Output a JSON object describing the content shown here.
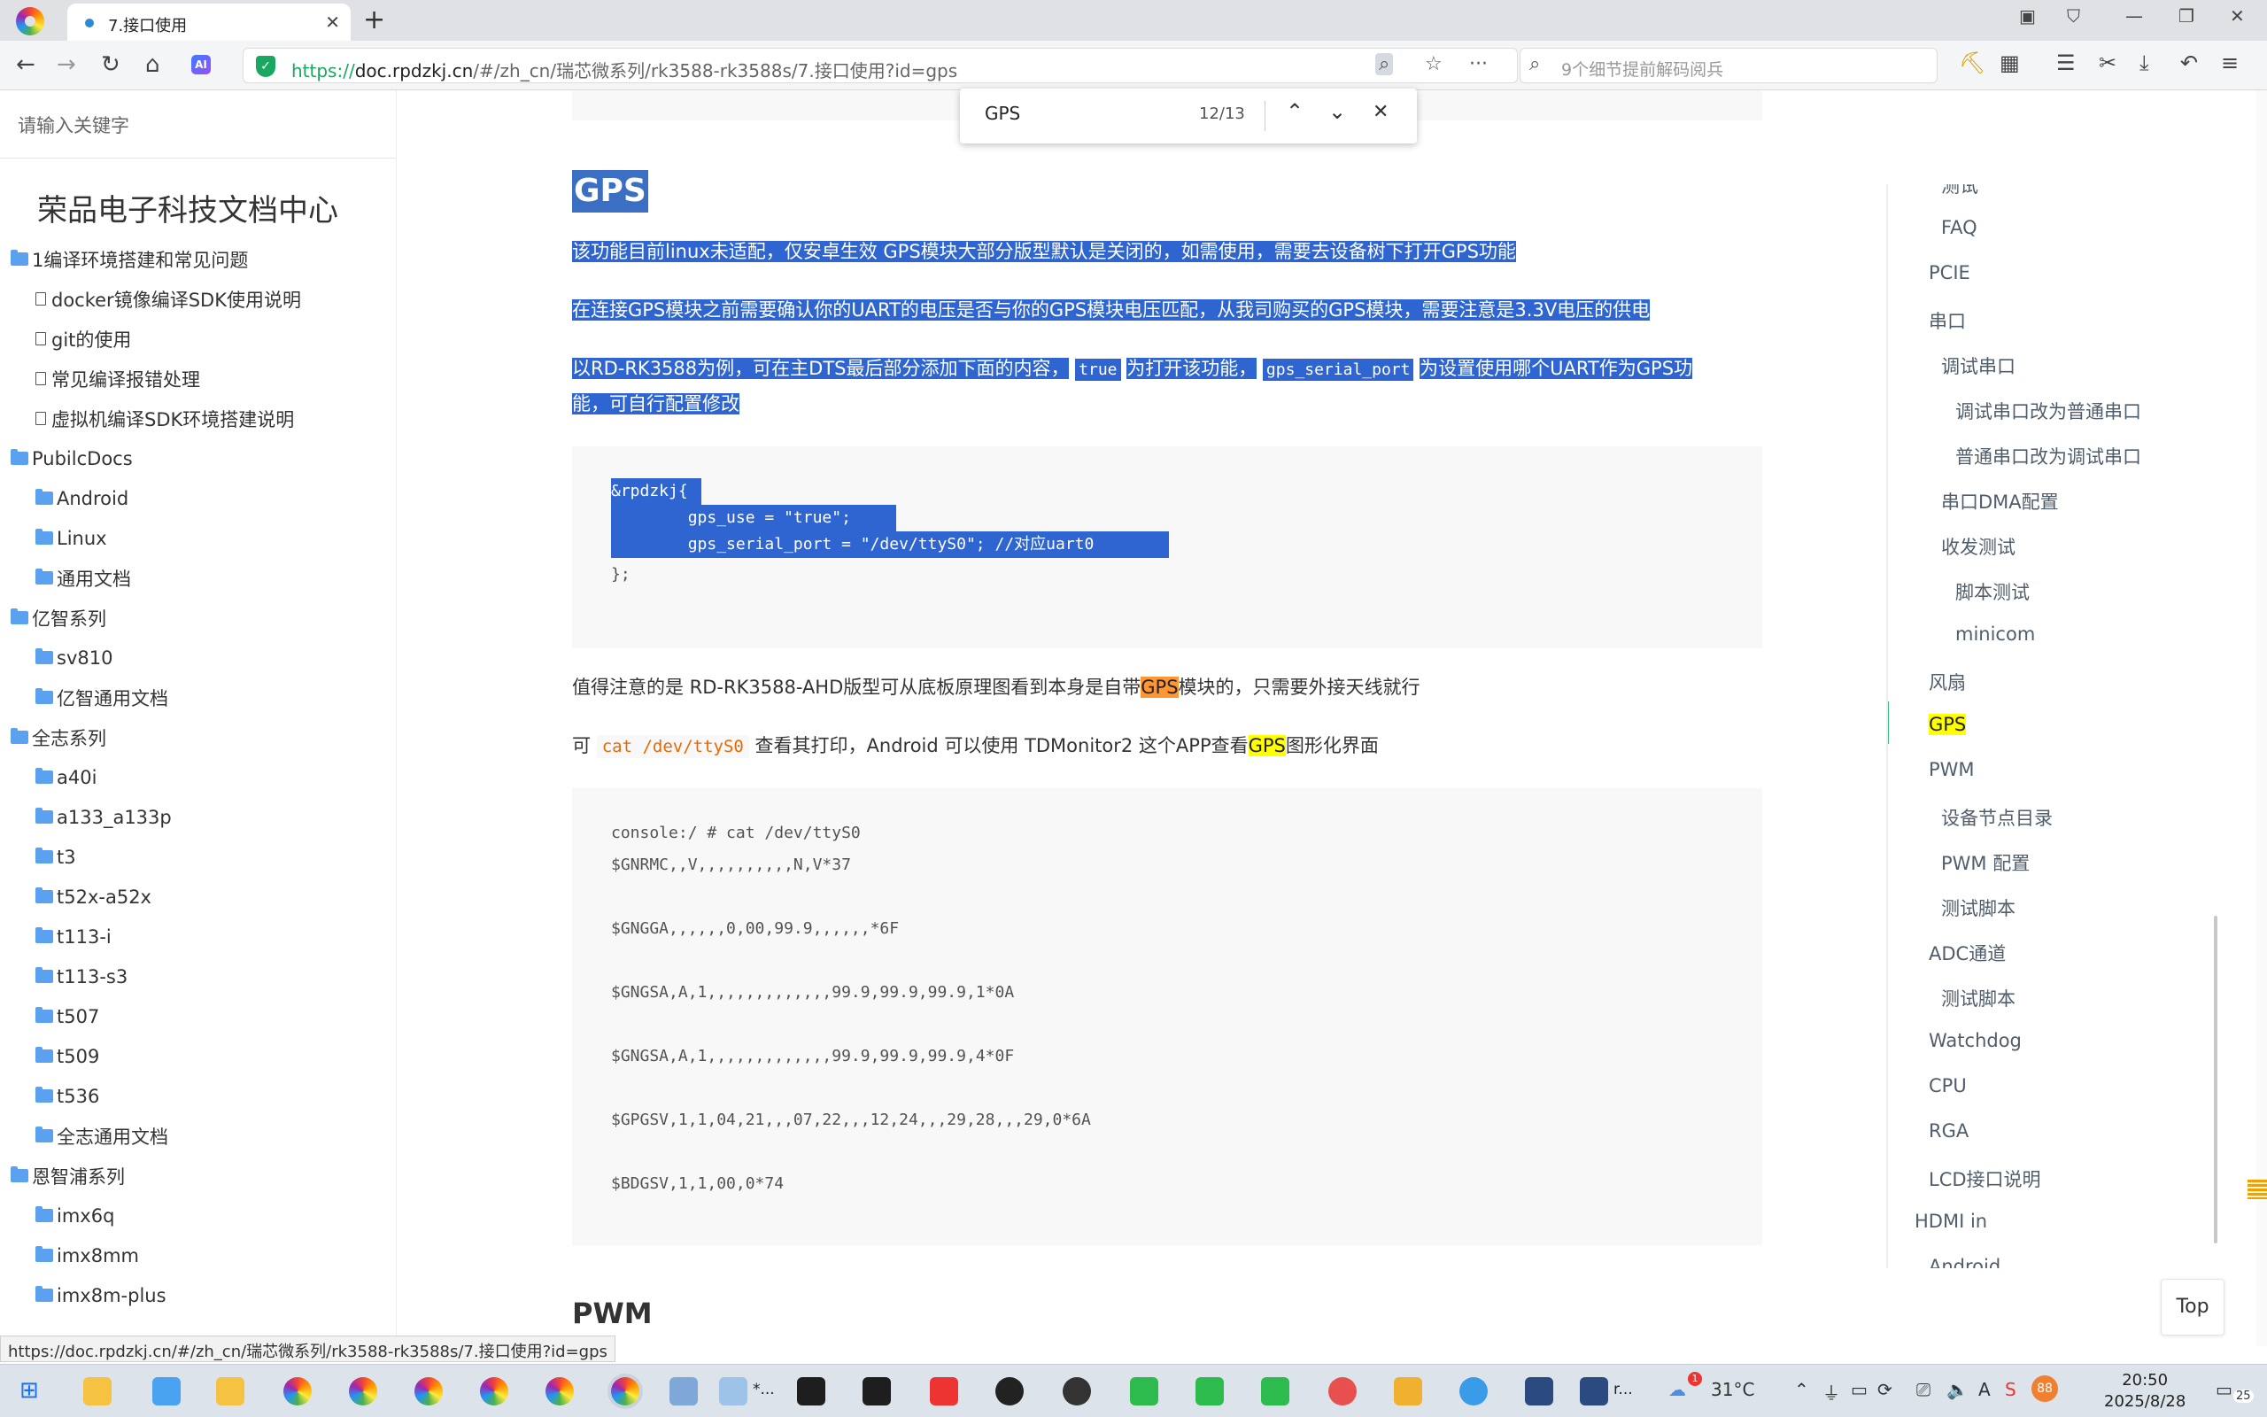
{
  "browser": {
    "tab_title": "7.接口使用",
    "url_scheme": "https://",
    "url_host": "doc.rpdzkj.cn",
    "url_path": "/#/zh_cn/瑞芯微系列/rk3588-rk3588s/7.接口使用?id=gps",
    "search_placeholder": "9个细节提前解码阅兵",
    "ai_label": "AI"
  },
  "find": {
    "query": "GPS",
    "count": "12/13"
  },
  "sidebar": {
    "search_placeholder": "请输入关键字",
    "title": "荣品电子科技文档中心",
    "items": [
      {
        "label": "1编译环境搭建和常见问题",
        "level": 0,
        "icon": "folder-icon"
      },
      {
        "label": "docker镜像编译SDK使用说明",
        "level": 1,
        "icon": "doc-icon"
      },
      {
        "label": "git的使用",
        "level": 1,
        "icon": "doc-icon"
      },
      {
        "label": "常见编译报错处理",
        "level": 1,
        "icon": "doc-icon"
      },
      {
        "label": "虚拟机编译SDK环境搭建说明",
        "level": 1,
        "icon": "doc-icon"
      },
      {
        "label": "PubilcDocs",
        "level": 0,
        "icon": "folder-icon"
      },
      {
        "label": "Android",
        "level": 1,
        "icon": "folder-icon"
      },
      {
        "label": "Linux",
        "level": 1,
        "icon": "folder-icon"
      },
      {
        "label": "通用文档",
        "level": 1,
        "icon": "folder-icon"
      },
      {
        "label": "亿智系列",
        "level": 0,
        "icon": "folder-icon"
      },
      {
        "label": "sv810",
        "level": 1,
        "icon": "folder-icon"
      },
      {
        "label": "亿智通用文档",
        "level": 1,
        "icon": "folder-icon"
      },
      {
        "label": "全志系列",
        "level": 0,
        "icon": "folder-icon"
      },
      {
        "label": "a40i",
        "level": 1,
        "icon": "folder-icon"
      },
      {
        "label": "a133_a133p",
        "level": 1,
        "icon": "folder-icon"
      },
      {
        "label": "t3",
        "level": 1,
        "icon": "folder-icon"
      },
      {
        "label": "t52x-a52x",
        "level": 1,
        "icon": "folder-icon"
      },
      {
        "label": "t113-i",
        "level": 1,
        "icon": "folder-icon"
      },
      {
        "label": "t113-s3",
        "level": 1,
        "icon": "folder-icon"
      },
      {
        "label": "t507",
        "level": 1,
        "icon": "folder-icon"
      },
      {
        "label": "t509",
        "level": 1,
        "icon": "folder-icon"
      },
      {
        "label": "t536",
        "level": 1,
        "icon": "folder-icon"
      },
      {
        "label": "全志通用文档",
        "level": 1,
        "icon": "folder-icon"
      },
      {
        "label": "恩智浦系列",
        "level": 0,
        "icon": "folder-icon"
      },
      {
        "label": "imx6q",
        "level": 1,
        "icon": "folder-icon"
      },
      {
        "label": "imx8mm",
        "level": 1,
        "icon": "folder-icon"
      },
      {
        "label": "imx8m-plus",
        "level": 1,
        "icon": "folder-icon"
      }
    ]
  },
  "content": {
    "heading_gps": "GPS",
    "p1": "该功能目前linux未适配，仅安卓生效 GPS模块大部分版型默认是关闭的，如需使用，需要去设备树下打开GPS功能",
    "p2": "在连接GPS模块之前需要确认你的UART的电压是否与你的GPS模块电压匹配，从我司购买的GPS模块，需要注意是3.3V电压的供电",
    "p3_a": "以RD-RK3588为例，可在主DTS最后部分添加下面的内容，",
    "p3_code1": "true",
    "p3_b": "为打开该功能，",
    "p3_code2": "gps_serial_port",
    "p3_c": "为设置使用哪个UART作为GPS功",
    "p3_d": "能，可自行配置修改",
    "code1": [
      "&rpdzkj{",
      "        gps_use = \"true\";",
      "        gps_serial_port = \"/dev/ttyS0\"; //对应uart0",
      "};"
    ],
    "p4_a": "值得注意的是 RD-RK3588-AHD版型可从底板原理图看到本身是自带",
    "p4_hl": "GPS",
    "p4_b": "模块的，只需要外接天线就行",
    "p5_a": "可 ",
    "p5_code": "cat /dev/ttyS0",
    "p5_b": " 查看其打印，Android 可以使用 TDMonitor2 这个APP查看",
    "p5_hl": "GPS",
    "p5_c": "图形化界面",
    "code2": [
      "console:/ # cat /dev/ttyS0",
      "$GNRMC,,V,,,,,,,,,,N,V*37",
      "",
      "$GNGGA,,,,,,0,00,99.9,,,,,,*6F",
      "",
      "$GNGSA,A,1,,,,,,,,,,,,,99.9,99.9,99.9,1*0A",
      "",
      "$GNGSA,A,1,,,,,,,,,,,,,99.9,99.9,99.9,4*0F",
      "",
      "$GPGSV,1,1,04,21,,,07,22,,,12,24,,,29,28,,,29,0*6A",
      "",
      "$BDGSV,1,1,00,0*74"
    ],
    "heading_pwm": "PWM"
  },
  "toc": {
    "items": [
      {
        "label": "测试",
        "indent": 2
      },
      {
        "label": "FAQ",
        "indent": 2
      },
      {
        "label": "PCIE",
        "indent": 1
      },
      {
        "label": "串口",
        "indent": 1
      },
      {
        "label": "调试串口",
        "indent": 2
      },
      {
        "label": "调试串口改为普通串口",
        "indent": 3
      },
      {
        "label": "普通串口改为调试串口",
        "indent": 3
      },
      {
        "label": "串口DMA配置",
        "indent": 2
      },
      {
        "label": "收发测试",
        "indent": 2
      },
      {
        "label": "脚本测试",
        "indent": 3
      },
      {
        "label": "minicom",
        "indent": 3
      },
      {
        "label": "风扇",
        "indent": 1
      },
      {
        "label": "GPS",
        "indent": 1,
        "active": true
      },
      {
        "label": "PWM",
        "indent": 1
      },
      {
        "label": "设备节点目录",
        "indent": 2
      },
      {
        "label": "PWM 配置",
        "indent": 2
      },
      {
        "label": "测试脚本",
        "indent": 2
      },
      {
        "label": "ADC通道",
        "indent": 1
      },
      {
        "label": "测试脚本",
        "indent": 2
      },
      {
        "label": "Watchdog",
        "indent": 1
      },
      {
        "label": "CPU",
        "indent": 1
      },
      {
        "label": "RGA",
        "indent": 1
      },
      {
        "label": "LCD接口说明",
        "indent": 1
      },
      {
        "label": "HDMI in",
        "indent": 0
      },
      {
        "label": "Android",
        "indent": 1
      }
    ],
    "top_button": "Top"
  },
  "status_url": "https://doc.rpdzkj.cn/#/zh_cn/瑞芯微系列/rk3588-rk3588s/7.接口使用?id=gps",
  "taskbar": {
    "label_star": "*...",
    "label_r": "r...",
    "weather": "31°C",
    "weather_badge": "1",
    "tray_badge": "88",
    "time": "20:50",
    "date": "2025/8/28",
    "notification_count": "25"
  },
  "colors": {
    "selection": "#2f65d0",
    "find_current": "#ff9632",
    "find_match": "#ffff00",
    "toc_active": "#42b983"
  }
}
